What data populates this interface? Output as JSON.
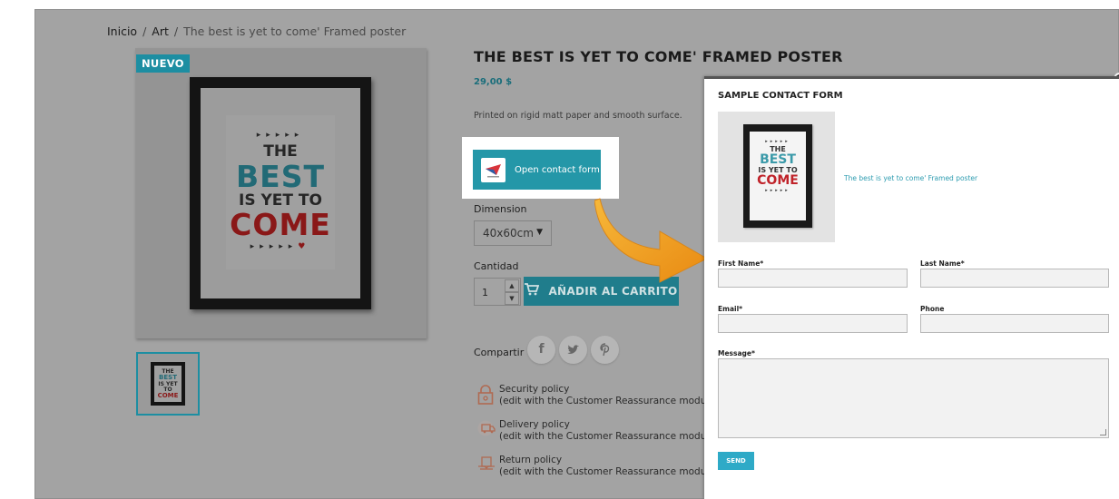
{
  "breadcrumb": {
    "home": "Inicio",
    "category": "Art",
    "current": "The best is yet to come' Framed poster"
  },
  "product": {
    "badge": "NUEVO",
    "title": "THE BEST IS YET TO COME' FRAMED POSTER",
    "price": "29,00 $",
    "description": "Printed on rigid matt paper and smooth surface.",
    "open_contact_label": "Open contact form",
    "dimension_label": "Dimension",
    "dimension_value": "40x60cm",
    "quantity_label": "Cantidad",
    "quantity_value": "1",
    "add_to_cart_label": "AÑADIR AL CARRITO",
    "share_label": "Compartir",
    "poster_text": {
      "the": "THE",
      "best": "BEST",
      "isyet": "IS YET TO",
      "come": "COME"
    }
  },
  "social": [
    {
      "icon": "facebook-icon",
      "glyph": "f"
    },
    {
      "icon": "twitter-icon",
      "glyph": "🐦"
    },
    {
      "icon": "pinterest-icon",
      "glyph": "P"
    }
  ],
  "policies": [
    {
      "icon": "lock-icon",
      "title": "Security policy",
      "subtitle": "(edit with the Customer Reassurance module)"
    },
    {
      "icon": "truck-icon",
      "title": "Delivery policy",
      "subtitle": "(edit with the Customer Reassurance module)"
    },
    {
      "icon": "return-icon",
      "title": "Return policy",
      "subtitle": "(edit with the Customer Reassurance module)"
    }
  ],
  "modal": {
    "title": "SAMPLE CONTACT FORM",
    "product_link": "The best is yet to come' Framed poster",
    "first_name_label": "First Name*",
    "last_name_label": "Last Name*",
    "email_label": "Email*",
    "phone_label": "Phone",
    "message_label": "Message*",
    "send_label": "SEND"
  },
  "colors": {
    "accent": "#2497a8",
    "overlay": "#a3a3a3",
    "link": "#2d9cb0",
    "arrow": "#f0a020"
  }
}
